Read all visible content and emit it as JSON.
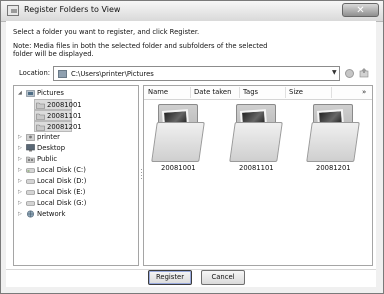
{
  "window": {
    "title": "Register Folders to View",
    "close_label": "✕"
  },
  "instructions": "Select a folder you want to register, and click Register.",
  "note": "Note: Media files in both the selected folder and subfolders of the selected folder will be displayed.",
  "location": {
    "label": "Location:",
    "value": "C:\\Users\\printer\\Pictures"
  },
  "tree": {
    "items": [
      {
        "label": "Pictures",
        "icon": "pictures-folder-icon",
        "expanded": true
      },
      {
        "label": "20081001",
        "icon": "folder-icon"
      },
      {
        "label": "20081101",
        "icon": "folder-icon"
      },
      {
        "label": "20081201",
        "icon": "folder-icon"
      },
      {
        "label": "printer",
        "icon": "user-folder-icon"
      },
      {
        "label": "Desktop",
        "icon": "desktop-icon"
      },
      {
        "label": "Public",
        "icon": "public-folder-icon"
      },
      {
        "label": "Local Disk (C:)",
        "icon": "disk-icon"
      },
      {
        "label": "Local Disk (D:)",
        "icon": "disk-icon"
      },
      {
        "label": "Local Disk (E:)",
        "icon": "disk-icon"
      },
      {
        "label": "Local Disk (G:)",
        "icon": "disk-icon"
      },
      {
        "label": "Network",
        "icon": "network-icon"
      }
    ]
  },
  "list": {
    "columns": [
      "Name",
      "Date taken",
      "Tags",
      "Size"
    ],
    "more_columns": "»",
    "folders": [
      "20081001",
      "20081101",
      "20081201"
    ]
  },
  "buttons": {
    "register": "Register",
    "cancel": "Cancel"
  }
}
